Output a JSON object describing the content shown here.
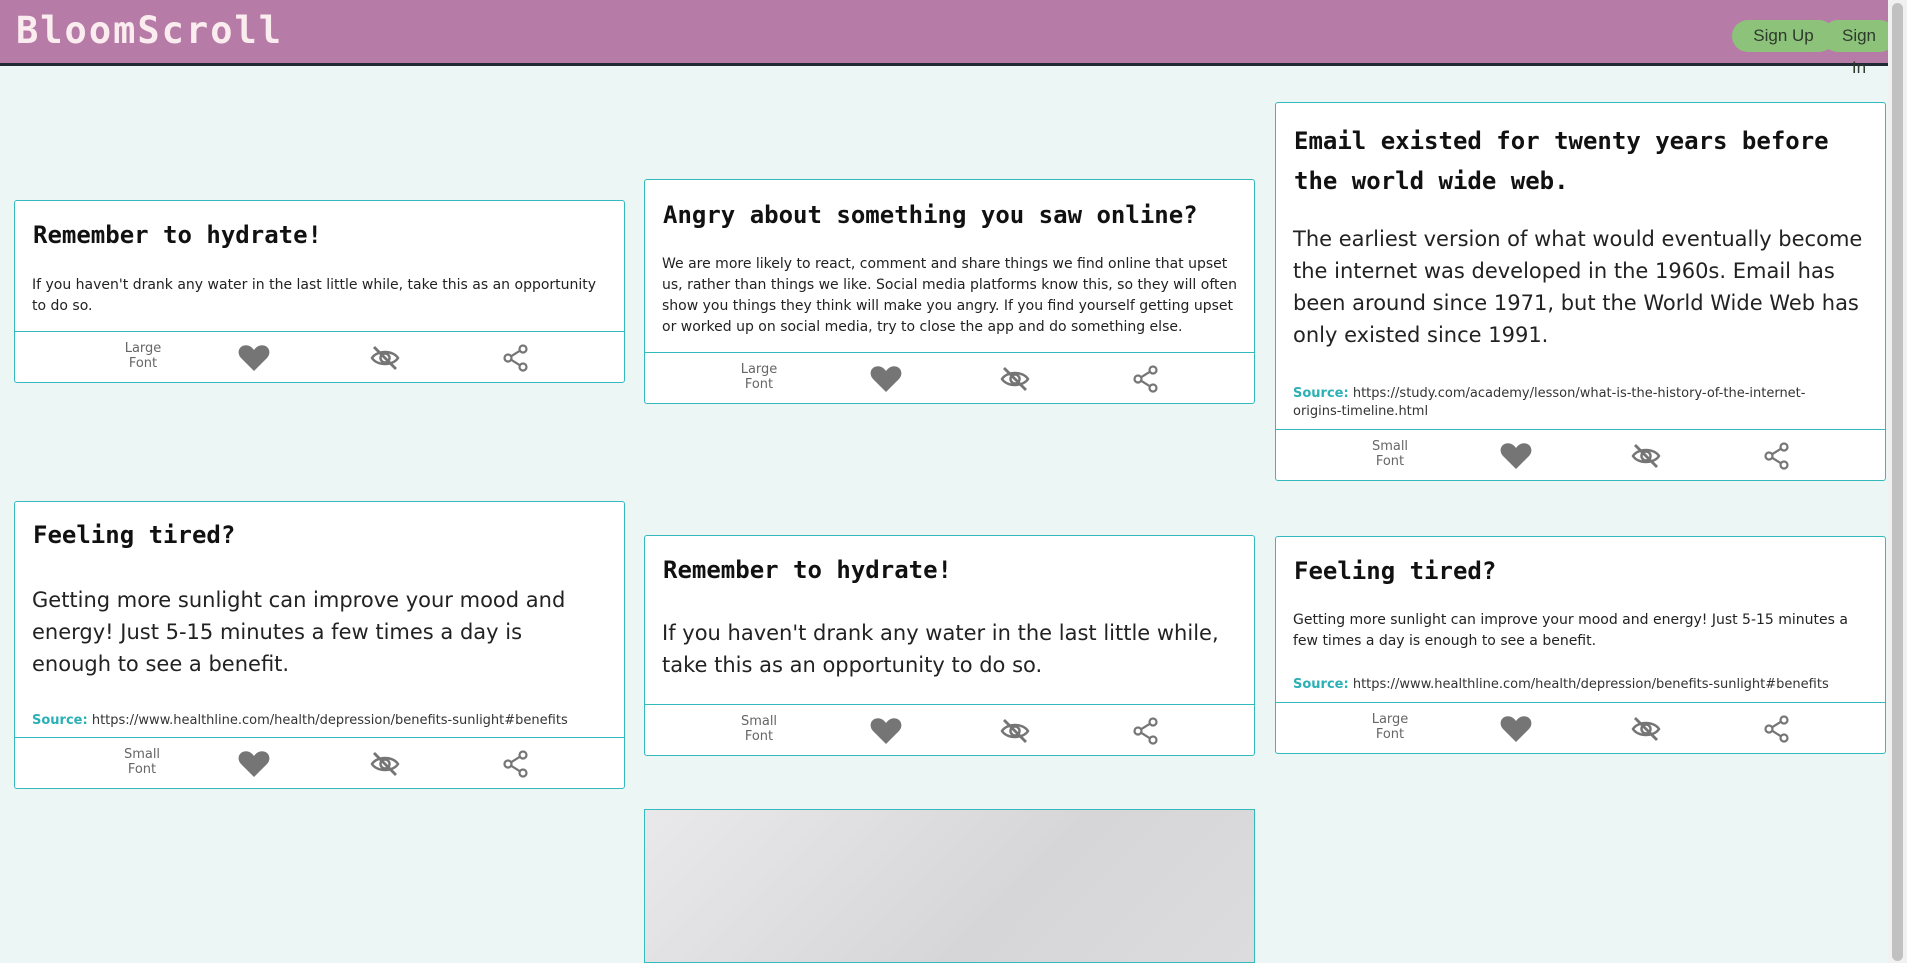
{
  "header": {
    "brand": "BloomScroll",
    "sign_up": "Sign Up",
    "sign_in": "Sign In"
  },
  "cards": [
    {
      "title": "Remember to hydrate!",
      "body": "If you haven't drank any water in the last little while, take this as an opportunity to do so.",
      "font_toggle": [
        "Large",
        "Font"
      ]
    },
    {
      "title": "Angry about something you saw online?",
      "body": "We are more likely to react, comment and share things we find online that upset us, rather than things we like. Social media platforms know this, so they will often show you things they think will make you angry. If you find yourself getting upset or worked up on social media, try to close the app and do something else.",
      "font_toggle": [
        "Large",
        "Font"
      ]
    },
    {
      "title": "Email existed for twenty years before the world wide web.",
      "body": "The earliest version of what would eventually become the internet was developed in the 1960s. Email has been around since 1971, but the World Wide Web has only existed since 1991.",
      "source_label": "Source:",
      "source_url": "https://study.com/academy/lesson/what-is-the-history-of-the-internet-origins-timeline.html",
      "font_toggle": [
        "Small",
        "Font"
      ]
    },
    {
      "title": "Feeling tired?",
      "body": "Getting more sunlight can improve your mood and energy! Just 5-15 minutes a few times a day is enough to see a benefit.",
      "source_label": "Source:",
      "source_url": "https://www.healthline.com/health/depression/benefits-sunlight#benefits",
      "font_toggle": [
        "Small",
        "Font"
      ]
    },
    {
      "title": "Remember to hydrate!",
      "body": "If you haven't drank any water in the last little while, take this as an opportunity to do so.",
      "font_toggle": [
        "Small",
        "Font"
      ]
    },
    {
      "title": "Feeling tired?",
      "body": "Getting more sunlight can improve your mood and energy! Just 5-15 minutes a few times a day is enough to see a benefit.",
      "source_label": "Source:",
      "source_url": "https://www.healthline.com/health/depression/benefits-sunlight#benefits",
      "font_toggle": [
        "Large",
        "Font"
      ]
    }
  ],
  "icons": {
    "like": "heart-icon",
    "hide": "eye-slash-icon",
    "share": "share-icon"
  },
  "colors": {
    "header_bg": "#b67ba6",
    "accent": "#34b9bd",
    "button_bg": "#8dc27b",
    "page_bg": "#ebf6f5"
  }
}
